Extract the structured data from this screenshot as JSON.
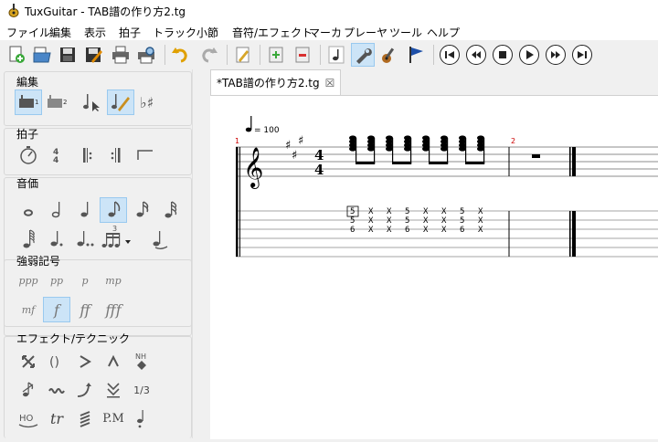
{
  "window": {
    "title": "TuxGuitar - TAB譜の作り方2.tg"
  },
  "menu": [
    "ファイル",
    "編集",
    "表示",
    "拍子",
    "トラック",
    "小節",
    "音符/エフェクト",
    "マーカ",
    "プレーヤ",
    "ツール",
    "ヘルプ"
  ],
  "tab": {
    "label": "*TAB譜の作り方2.tg",
    "close": "☒"
  },
  "panel": {
    "edit_label": "編集",
    "meter_label": "拍子",
    "duration_label": "音価",
    "dynamics_label": "強弱記号",
    "effects_label": "エフェクト/テクニック",
    "dynamics": [
      "ppp",
      "pp",
      "p",
      "mp",
      "mf",
      "f",
      "ff",
      "fff"
    ],
    "effects_text": {
      "nh": "NH",
      "ratio": "1/3",
      "ho": "HO",
      "tr": "tr",
      "pm": "P.M"
    },
    "tuplet": "3"
  },
  "score": {
    "tempo": "= 100",
    "time_signature": {
      "top": "4",
      "bottom": "4"
    },
    "measure_numbers": [
      "1",
      "2"
    ],
    "tab_columns": [
      [
        "5",
        "5",
        "6"
      ],
      [
        "X",
        "X",
        "X"
      ],
      [
        "X",
        "X",
        "X"
      ],
      [
        "5",
        "5",
        "6"
      ],
      [
        "X",
        "X",
        "X"
      ],
      [
        "X",
        "X",
        "X"
      ],
      [
        "5",
        "5",
        "6"
      ],
      [
        "X",
        "X",
        "X"
      ]
    ]
  }
}
